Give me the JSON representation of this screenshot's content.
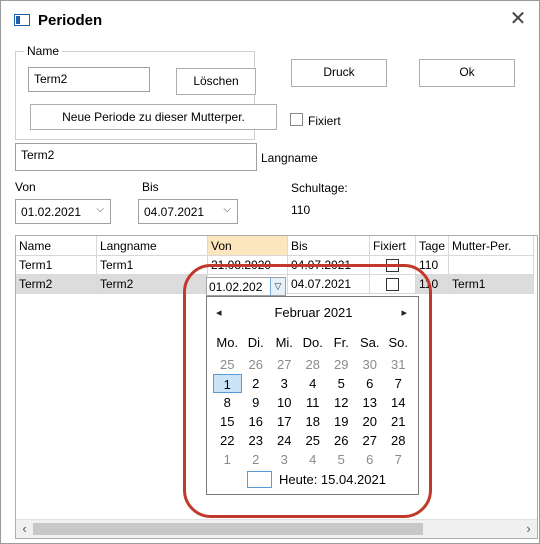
{
  "window": {
    "title": "Perioden",
    "close_glyph": "✕"
  },
  "name_group": {
    "legend": "Name",
    "name_value": "Term2",
    "delete_button": "Löschen",
    "new_period_button": "Neue Periode zu dieser Mutterper."
  },
  "buttons": {
    "print": "Druck",
    "ok": "Ok"
  },
  "fixed_label": "Fixiert",
  "longname": {
    "value": "Term2",
    "label": "Langname"
  },
  "period": {
    "from_label": "Von",
    "to_label": "Bis",
    "from_value": "01.02.2021",
    "to_value": "04.07.2021",
    "school_days_label": "Schultage:",
    "school_days_value": "110"
  },
  "table": {
    "columns": [
      "Name",
      "Langname",
      "Von",
      "Bis",
      "Fixiert",
      "Tage",
      "Mutter-Per."
    ],
    "rows": [
      {
        "name": "Term1",
        "longname": "Term1",
        "from": "21.08.2020",
        "to": "04.07.2021",
        "days": "110",
        "parent": ""
      },
      {
        "name": "Term2",
        "longname": "Term2",
        "from": "01.02.202",
        "to": "04.07.2021",
        "days": "110",
        "parent": "Term1"
      }
    ]
  },
  "calendar": {
    "month_label": "Februar 2021",
    "prev": "◂",
    "next": "▸",
    "weekdays": [
      "Mo.",
      "Di.",
      "Mi.",
      "Do.",
      "Fr.",
      "Sa.",
      "So."
    ],
    "weeks": [
      [
        "25",
        "26",
        "27",
        "28",
        "29",
        "30",
        "31"
      ],
      [
        "1",
        "2",
        "3",
        "4",
        "5",
        "6",
        "7"
      ],
      [
        "8",
        "9",
        "10",
        "11",
        "12",
        "13",
        "14"
      ],
      [
        "15",
        "16",
        "17",
        "18",
        "19",
        "20",
        "21"
      ],
      [
        "22",
        "23",
        "24",
        "25",
        "26",
        "27",
        "28"
      ],
      [
        "1",
        "2",
        "3",
        "4",
        "5",
        "6",
        "7"
      ]
    ],
    "selected_day": "1",
    "today_label": "Heute: 15.04.2021"
  },
  "colors": {
    "highlight": "#c0392b",
    "selected_header": "#fbe6bd",
    "selected_row": "#dcdcdc"
  }
}
